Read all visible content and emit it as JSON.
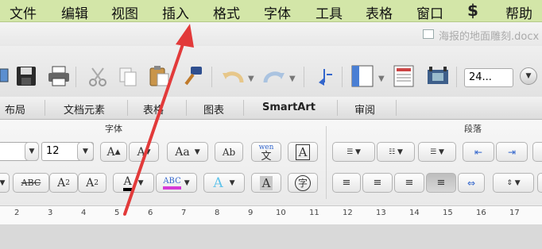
{
  "menubar": {
    "items": [
      "文件",
      "编辑",
      "视图",
      "插入",
      "格式",
      "字体",
      "工具",
      "表格",
      "窗口",
      "帮助"
    ]
  },
  "window": {
    "title_fragment": "海报的地面雕刻.docx"
  },
  "toolbar": {
    "zoom_value": "24..."
  },
  "ribbon_tabs": [
    "布局",
    "文档元素",
    "表格",
    "图表",
    "SmartArt",
    "审阅"
  ],
  "ribbon": {
    "font_group_label": "字体",
    "paragraph_group_label": "段落",
    "font_size": "12",
    "buttons": {
      "grow_font": "A",
      "shrink_font": "A",
      "change_case": "Aa",
      "clear_format": "Ab",
      "phonetic_top": "wen",
      "phonetic_char": "文",
      "char_border": "A",
      "strikethrough": "ABC",
      "superscript_base": "A",
      "superscript_exp": "2",
      "subscript_base": "A",
      "subscript_exp": "2",
      "font_color": "A",
      "highlight": "ABC",
      "text_effect": "A",
      "char_shading": "A",
      "enclosed_char": "字"
    }
  },
  "ruler": {
    "ticks": [
      "2",
      "3",
      "4",
      "5",
      "6",
      "7",
      "8",
      "9",
      "10",
      "11",
      "12",
      "13",
      "14",
      "15",
      "16",
      "17"
    ]
  },
  "annotation": {
    "arrow_color": "#e23a3a"
  },
  "colors": {
    "menubar_bg": "#d3e6a8",
    "font_color_bar": "#000000",
    "highlight_bar": "#d63ad6"
  }
}
